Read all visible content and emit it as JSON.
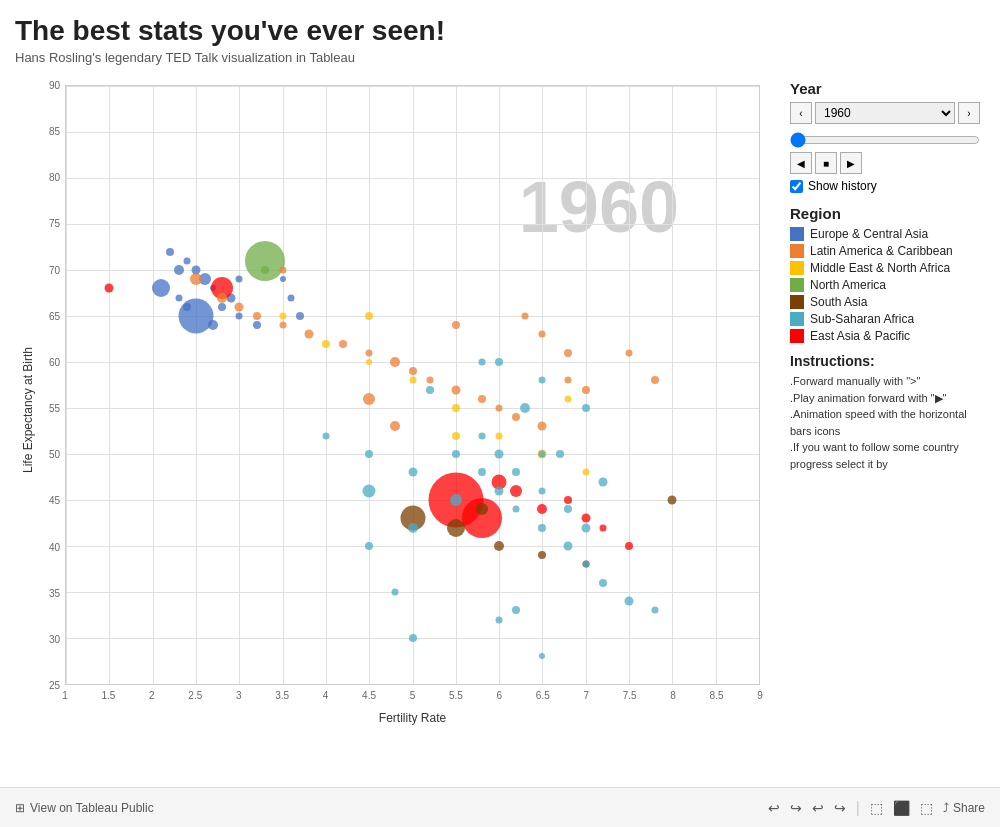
{
  "title": "The best stats you've ever seen!",
  "subtitle": "Hans Rosling's legendary TED Talk visualization in Tableau",
  "year": {
    "label": "Year",
    "value": "1960",
    "prev_btn": "‹",
    "next_btn": "›",
    "show_history_label": "Show history"
  },
  "region": {
    "label": "Region",
    "items": [
      {
        "name": "Europe & Central Asia",
        "color": "#4472C4"
      },
      {
        "name": "Latin America & Caribbean",
        "color": "#ED7D31"
      },
      {
        "name": "Middle East & North Africa",
        "color": "#FFC000"
      },
      {
        "name": "North America",
        "color": "#70AD47"
      },
      {
        "name": "South Asia",
        "color": "#7B3F00"
      },
      {
        "name": "Sub-Saharan Africa",
        "color": "#4BACC6"
      },
      {
        "name": "East Asia & Pacific",
        "color": "#FF0000"
      }
    ]
  },
  "instructions": {
    "title": "Instructions:",
    "lines": [
      ".Forward manually with \">\"",
      ".Play animation forward with \"▶\"",
      ".Animation speed with the horizontal bars icons",
      ".If you want to follow some country progress select it by"
    ]
  },
  "axes": {
    "x_label": "Fertility Rate",
    "y_label": "Life Expectancy at Birth",
    "x_ticks": [
      "1.0",
      "1.5",
      "2.0",
      "2.5",
      "3.0",
      "3.5",
      "4.0",
      "4.5",
      "5.0",
      "5.5",
      "6.0",
      "6.5",
      "7.0",
      "7.5",
      "8.0",
      "8.5",
      "9.0"
    ],
    "y_ticks": [
      "25",
      "30",
      "35",
      "40",
      "45",
      "50",
      "55",
      "60",
      "65",
      "70",
      "75",
      "80",
      "85",
      "90"
    ]
  },
  "year_watermark": "1960",
  "footer": {
    "tableau_icon": "⊞",
    "view_label": "View on Tableau Public",
    "share_label": "Share"
  },
  "bubbles": [
    {
      "x": 2.1,
      "y": 68,
      "r": 18,
      "region": 0
    },
    {
      "x": 2.2,
      "y": 72,
      "r": 8,
      "region": 0
    },
    {
      "x": 2.3,
      "y": 70,
      "r": 10,
      "region": 0
    },
    {
      "x": 2.4,
      "y": 71,
      "r": 7,
      "region": 0
    },
    {
      "x": 2.5,
      "y": 70,
      "r": 9,
      "region": 0
    },
    {
      "x": 2.6,
      "y": 69,
      "r": 12,
      "region": 0
    },
    {
      "x": 2.7,
      "y": 68,
      "r": 6,
      "region": 0
    },
    {
      "x": 2.3,
      "y": 67,
      "r": 7,
      "region": 0
    },
    {
      "x": 2.4,
      "y": 66,
      "r": 8,
      "region": 0
    },
    {
      "x": 2.5,
      "y": 65,
      "r": 35,
      "region": 0
    },
    {
      "x": 2.7,
      "y": 64,
      "r": 10,
      "region": 0
    },
    {
      "x": 2.8,
      "y": 66,
      "r": 8,
      "region": 0
    },
    {
      "x": 2.9,
      "y": 67,
      "r": 9,
      "region": 0
    },
    {
      "x": 3.0,
      "y": 65,
      "r": 7,
      "region": 0
    },
    {
      "x": 3.2,
      "y": 64,
      "r": 8,
      "region": 0
    },
    {
      "x": 3.5,
      "y": 69,
      "r": 6,
      "region": 0
    },
    {
      "x": 3.6,
      "y": 67,
      "r": 7,
      "region": 0
    },
    {
      "x": 3.7,
      "y": 65,
      "r": 8,
      "region": 0
    },
    {
      "x": 1.5,
      "y": 68,
      "r": 9,
      "region": 6
    },
    {
      "x": 2.8,
      "y": 68,
      "r": 22,
      "region": 6
    },
    {
      "x": 3.3,
      "y": 70,
      "r": 8,
      "region": 3
    },
    {
      "x": 3.3,
      "y": 71,
      "r": 40,
      "region": 3
    },
    {
      "x": 3.5,
      "y": 70,
      "r": 7,
      "region": 1
    },
    {
      "x": 2.5,
      "y": 69,
      "r": 12,
      "region": 1
    },
    {
      "x": 2.8,
      "y": 67,
      "r": 10,
      "region": 1
    },
    {
      "x": 3.0,
      "y": 66,
      "r": 9,
      "region": 1
    },
    {
      "x": 3.2,
      "y": 65,
      "r": 8,
      "region": 1
    },
    {
      "x": 3.5,
      "y": 64,
      "r": 7,
      "region": 1
    },
    {
      "x": 3.8,
      "y": 63,
      "r": 9,
      "region": 1
    },
    {
      "x": 4.2,
      "y": 62,
      "r": 8,
      "region": 1
    },
    {
      "x": 4.5,
      "y": 61,
      "r": 7,
      "region": 1
    },
    {
      "x": 4.8,
      "y": 60,
      "r": 10,
      "region": 1
    },
    {
      "x": 5.0,
      "y": 59,
      "r": 8,
      "region": 1
    },
    {
      "x": 5.2,
      "y": 58,
      "r": 7,
      "region": 1
    },
    {
      "x": 5.5,
      "y": 57,
      "r": 9,
      "region": 1
    },
    {
      "x": 5.8,
      "y": 56,
      "r": 8,
      "region": 1
    },
    {
      "x": 6.0,
      "y": 55,
      "r": 7,
      "region": 1
    },
    {
      "x": 6.2,
      "y": 54,
      "r": 8,
      "region": 1
    },
    {
      "x": 6.5,
      "y": 53,
      "r": 9,
      "region": 1
    },
    {
      "x": 6.8,
      "y": 58,
      "r": 7,
      "region": 1
    },
    {
      "x": 7.0,
      "y": 57,
      "r": 8,
      "region": 1
    },
    {
      "x": 3.5,
      "y": 65,
      "r": 7,
      "region": 2
    },
    {
      "x": 4.0,
      "y": 62,
      "r": 8,
      "region": 2
    },
    {
      "x": 4.5,
      "y": 60,
      "r": 6,
      "region": 2
    },
    {
      "x": 5.0,
      "y": 58,
      "r": 7,
      "region": 2
    },
    {
      "x": 5.5,
      "y": 55,
      "r": 8,
      "region": 2
    },
    {
      "x": 6.0,
      "y": 52,
      "r": 7,
      "region": 2
    },
    {
      "x": 6.5,
      "y": 50,
      "r": 9,
      "region": 2
    },
    {
      "x": 7.0,
      "y": 48,
      "r": 7,
      "region": 2
    },
    {
      "x": 5.5,
      "y": 45,
      "r": 55,
      "region": 6
    },
    {
      "x": 5.8,
      "y": 43,
      "r": 40,
      "region": 6
    },
    {
      "x": 6.0,
      "y": 47,
      "r": 15,
      "region": 6
    },
    {
      "x": 6.2,
      "y": 46,
      "r": 12,
      "region": 6
    },
    {
      "x": 6.5,
      "y": 44,
      "r": 10,
      "region": 6
    },
    {
      "x": 6.8,
      "y": 45,
      "r": 8,
      "region": 6
    },
    {
      "x": 7.0,
      "y": 43,
      "r": 9,
      "region": 6
    },
    {
      "x": 7.2,
      "y": 42,
      "r": 7,
      "region": 6
    },
    {
      "x": 7.5,
      "y": 40,
      "r": 8,
      "region": 6
    },
    {
      "x": 5.0,
      "y": 43,
      "r": 25,
      "region": 4
    },
    {
      "x": 5.5,
      "y": 42,
      "r": 18,
      "region": 4
    },
    {
      "x": 5.8,
      "y": 44,
      "r": 12,
      "region": 4
    },
    {
      "x": 6.0,
      "y": 40,
      "r": 10,
      "region": 4
    },
    {
      "x": 6.5,
      "y": 39,
      "r": 8,
      "region": 4
    },
    {
      "x": 7.0,
      "y": 38,
      "r": 7,
      "region": 4
    },
    {
      "x": 8.0,
      "y": 45,
      "r": 9,
      "region": 4
    },
    {
      "x": 4.5,
      "y": 40,
      "r": 8,
      "region": 5
    },
    {
      "x": 5.0,
      "y": 42,
      "r": 10,
      "region": 5
    },
    {
      "x": 5.5,
      "y": 45,
      "r": 12,
      "region": 5
    },
    {
      "x": 5.8,
      "y": 48,
      "r": 8,
      "region": 5
    },
    {
      "x": 6.0,
      "y": 46,
      "r": 9,
      "region": 5
    },
    {
      "x": 6.2,
      "y": 44,
      "r": 7,
      "region": 5
    },
    {
      "x": 6.5,
      "y": 42,
      "r": 8,
      "region": 5
    },
    {
      "x": 6.8,
      "y": 40,
      "r": 9,
      "region": 5
    },
    {
      "x": 7.0,
      "y": 38,
      "r": 7,
      "region": 5
    },
    {
      "x": 7.2,
      "y": 36,
      "r": 8,
      "region": 5
    },
    {
      "x": 7.5,
      "y": 34,
      "r": 9,
      "region": 5
    },
    {
      "x": 7.8,
      "y": 33,
      "r": 7,
      "region": 5
    },
    {
      "x": 6.0,
      "y": 60,
      "r": 8,
      "region": 5
    },
    {
      "x": 6.5,
      "y": 58,
      "r": 7,
      "region": 5
    },
    {
      "x": 7.0,
      "y": 55,
      "r": 8,
      "region": 5
    },
    {
      "x": 4.0,
      "y": 52,
      "r": 7,
      "region": 5
    },
    {
      "x": 4.5,
      "y": 50,
      "r": 8,
      "region": 5
    },
    {
      "x": 5.0,
      "y": 48,
      "r": 9,
      "region": 5
    },
    {
      "x": 5.5,
      "y": 50,
      "r": 8,
      "region": 5
    },
    {
      "x": 5.8,
      "y": 52,
      "r": 7,
      "region": 5
    },
    {
      "x": 6.0,
      "y": 50,
      "r": 9,
      "region": 5
    },
    {
      "x": 6.2,
      "y": 48,
      "r": 8,
      "region": 5
    },
    {
      "x": 6.5,
      "y": 46,
      "r": 7,
      "region": 5
    },
    {
      "x": 6.8,
      "y": 44,
      "r": 8,
      "region": 5
    },
    {
      "x": 7.0,
      "y": 42,
      "r": 9,
      "region": 5
    },
    {
      "x": 4.8,
      "y": 35,
      "r": 7,
      "region": 5
    },
    {
      "x": 5.0,
      "y": 30,
      "r": 8,
      "region": 5
    },
    {
      "x": 6.0,
      "y": 32,
      "r": 7,
      "region": 5
    },
    {
      "x": 6.5,
      "y": 28,
      "r": 6,
      "region": 5
    },
    {
      "x": 5.5,
      "y": 64,
      "r": 8,
      "region": 1
    },
    {
      "x": 6.5,
      "y": 63,
      "r": 7,
      "region": 1
    },
    {
      "x": 6.8,
      "y": 61,
      "r": 8,
      "region": 1
    },
    {
      "x": 4.5,
      "y": 46,
      "r": 13,
      "region": 5
    },
    {
      "x": 5.2,
      "y": 57,
      "r": 8,
      "region": 5
    },
    {
      "x": 5.8,
      "y": 60,
      "r": 7,
      "region": 5
    },
    {
      "x": 6.3,
      "y": 55,
      "r": 10,
      "region": 5
    },
    {
      "x": 6.7,
      "y": 50,
      "r": 8,
      "region": 5
    },
    {
      "x": 7.2,
      "y": 47,
      "r": 9,
      "region": 5
    },
    {
      "x": 6.3,
      "y": 65,
      "r": 7,
      "region": 1
    },
    {
      "x": 5.5,
      "y": 52,
      "r": 8,
      "region": 2
    },
    {
      "x": 3.0,
      "y": 69,
      "r": 7,
      "region": 0
    },
    {
      "x": 4.5,
      "y": 65,
      "r": 8,
      "region": 2
    },
    {
      "x": 7.5,
      "y": 61,
      "r": 7,
      "region": 1
    },
    {
      "x": 7.8,
      "y": 58,
      "r": 8,
      "region": 1
    },
    {
      "x": 4.5,
      "y": 56,
      "r": 12,
      "region": 1
    },
    {
      "x": 4.8,
      "y": 53,
      "r": 10,
      "region": 1
    },
    {
      "x": 6.5,
      "y": 50,
      "r": 7,
      "region": 5
    },
    {
      "x": 6.2,
      "y": 33,
      "r": 8,
      "region": 5
    },
    {
      "x": 6.8,
      "y": 56,
      "r": 7,
      "region": 2
    }
  ]
}
